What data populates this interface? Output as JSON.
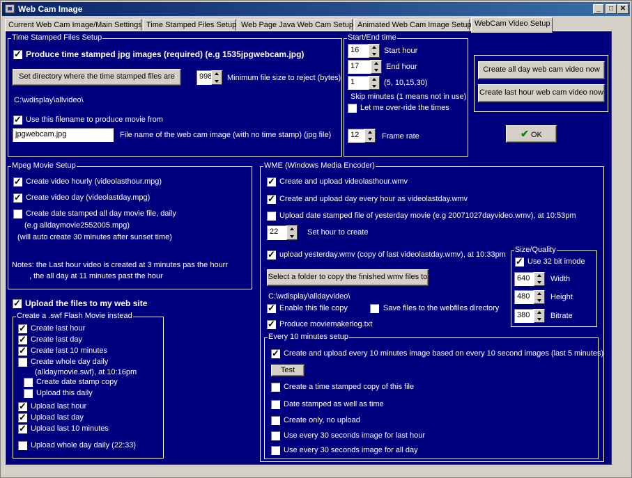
{
  "window": {
    "title": "Web Cam Image",
    "minimize": "_",
    "maximize": "□",
    "close": "✕"
  },
  "tabs": [
    "Current Web Cam Image/Main Settings",
    "Time Stamped Files Setup",
    "Web Page Java Web Cam Setup",
    "Animated Web Cam Image Setup",
    "WebCam Video Setup"
  ],
  "tsf": {
    "title": "Time Stamped Files Setup",
    "produce_label": "Produce time stamped jpg images (required) (e.g 1535jpgwebcam.jpg)",
    "set_dir_button": "Set directory where the time stamped files are",
    "min_size_value": "998",
    "min_size_label": "Minimum file size to reject (bytes)",
    "dir_path": "C:\\wdisplay\\allvideo\\",
    "use_filename_label": "Use this filename to produce movie from",
    "filename_value": "jpgwebcam.jpg",
    "filename_label": "File name of the web cam image (with no time stamp) (jpg file)"
  },
  "se": {
    "title": "Start/End time",
    "start_value": "16",
    "start_label": "Start hour",
    "end_value": "17",
    "end_label": "End hour",
    "skip_value": "1",
    "skip_hint": "(5, 10,15,30)",
    "skip_label": "Skip minutes (1 means not in use)",
    "override_label": "Let me over-ride the times",
    "frame_value": "12",
    "frame_label": "Frame rate"
  },
  "actions": {
    "all_day_button": "Create all day web cam video now",
    "last_hour_button": "Create last hour web cam video now",
    "ok_button": "OK"
  },
  "mpeg": {
    "title": "Mpeg Movie Setup",
    "hourly_label": "Create video hourly (videolasthour.mpg)",
    "day_label": "Create video day  (videolastday.mpg)",
    "date_stamped_label": "Create date stamped all day movie file, daily",
    "example": "(e.g alldaymovie2552005.mpg)",
    "auto_note": "(will auto create 30 minutes after sunset time)",
    "notes1": "Notes: the Last hour video is created at 3 minutes pas the hourr",
    "notes2": ", the all day at 11 minutes past the hour"
  },
  "upload_label": "Upload the files to my web site",
  "swf": {
    "title": "Create a .swf Flash Movie instead",
    "items": {
      "last_hour": "Create last hour",
      "last_day": "Create last day",
      "last_10": "Create last 10 minutes",
      "whole_day": "Create whole day daily",
      "whole_day_note": "(alldaymovie.swf), at 10:16pm",
      "date_stamp_copy": "Create date stamp copy",
      "upload_daily": "Upload this daily",
      "upload_last_hour": "Upload last hour",
      "upload_last_day": "Upload last day",
      "upload_last_10": "Upload last 10 minutes",
      "upload_whole_day": "Upload whole day daily (22:33)"
    }
  },
  "wme": {
    "title": "WME (Windows Media Encoder)",
    "lasthour_label": "Create and upload videolasthour.wmv",
    "lastday_label": "Create and upload day every hour as videolastday.wmv",
    "datestamp_label": "Upload date stamped file of yesterday movie (e.g 20071027dayvideo.wmv), at 10:53pm",
    "hour_value": "22",
    "hour_label": "Set hour to create",
    "yesterday_label": "upload yesterday.wmv (copy of last videolastday.wmv), at 10:33pm",
    "select_folder_button": "Select a folder to copy the finished wmv files to",
    "folder_path": "C:\\wdisplay\\alldayvideo\\",
    "enable_copy_label": "Enable this file copy",
    "save_webfiles_label": "Save files to the webfiles directory",
    "produce_log_label": "Produce moviemakerlog.txt"
  },
  "size": {
    "title": "Size/Quality",
    "use32_label": "Use 32 bit imode",
    "width_value": "640",
    "width_label": "Width",
    "height_value": "480",
    "height_label": "Height",
    "bitrate_value": "380",
    "bitrate_label": "Bitrate"
  },
  "ten": {
    "title": "Every 10 minutes setup",
    "create_upload_label": "Create and upload every 10 minutes image based on every 10 second images (last 5 minutes)",
    "test_button": "Test",
    "stamped_copy_label": "Create a time stamped copy of this file",
    "date_time_label": "Date stamped as well as time",
    "create_only_label": "Create only, no upload",
    "use30_hour_label": "Use every 30 seconds image for last hour",
    "use30_day_label": "Use every 30 seconds image for all day"
  }
}
